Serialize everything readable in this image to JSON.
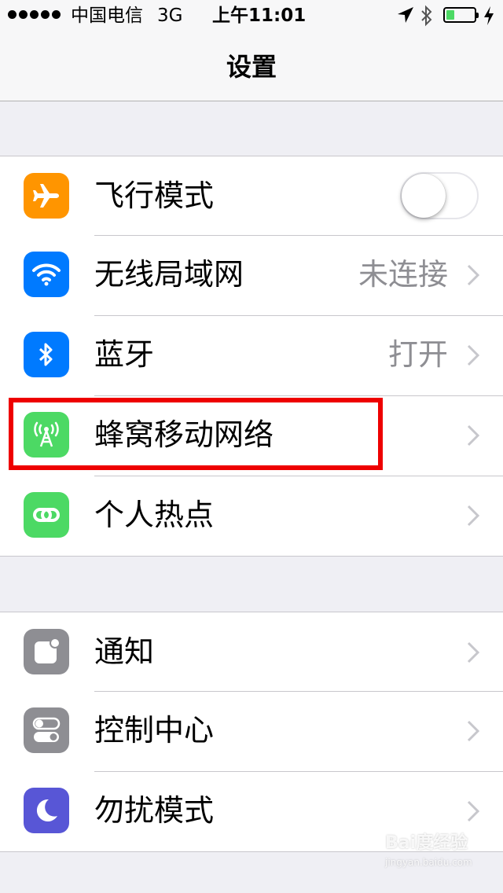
{
  "status_bar": {
    "carrier": "中国电信",
    "network": "3G",
    "time": "上午11:01",
    "battery_level": 0.3
  },
  "nav": {
    "title": "设置"
  },
  "group1": [
    {
      "label": "飞行模式",
      "icon": "airplane-icon",
      "icon_color": "#ff9500",
      "toggle": false
    },
    {
      "label": "无线局域网",
      "icon": "wifi-icon",
      "icon_color": "#007aff",
      "value": "未连接"
    },
    {
      "label": "蓝牙",
      "icon": "bluetooth-icon",
      "icon_color": "#007aff",
      "value": "打开"
    },
    {
      "label": "蜂窝移动网络",
      "icon": "cellular-icon",
      "icon_color": "#4cd964"
    },
    {
      "label": "个人热点",
      "icon": "hotspot-icon",
      "icon_color": "#4cd964"
    }
  ],
  "group2": [
    {
      "label": "通知",
      "icon": "notifications-icon",
      "icon_color": "#8e8e93"
    },
    {
      "label": "控制中心",
      "icon": "control-center-icon",
      "icon_color": "#8e8e93"
    },
    {
      "label": "勿扰模式",
      "icon": "moon-icon",
      "icon_color": "#5856d6"
    }
  ],
  "watermark": {
    "main": "Bai度经验",
    "sub": "jingyan.baidu.com"
  },
  "colors": {
    "highlight": "#ee0000",
    "toggle_off_border": "#e5e5ea"
  }
}
